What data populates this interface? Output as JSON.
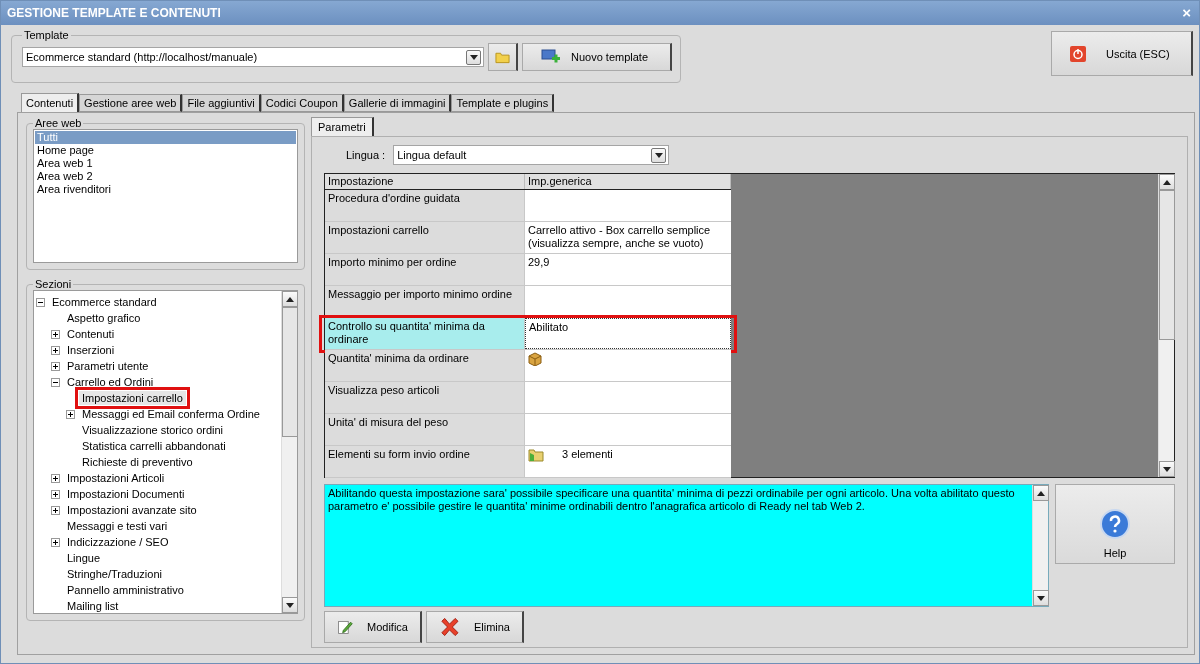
{
  "window": {
    "title": "GESTIONE TEMPLATE E CONTENUTI",
    "close": "×"
  },
  "template_group": {
    "label": "Template",
    "select_value": "Ecommerce standard (http://localhost/manuale)",
    "new_button": "Nuovo template"
  },
  "exit_button": "Uscita (ESC)",
  "tabs": [
    {
      "label": "Contenuti",
      "selected": true
    },
    {
      "label": "Gestione aree web",
      "selected": false
    },
    {
      "label": "File aggiuntivi",
      "selected": false
    },
    {
      "label": "Codici Coupon",
      "selected": false
    },
    {
      "label": "Gallerie di immagini",
      "selected": false
    },
    {
      "label": "Template e plugins",
      "selected": false
    }
  ],
  "aree_web": {
    "label": "Aree web",
    "items": [
      {
        "label": "Tutti",
        "selected": true
      },
      {
        "label": "Home page",
        "selected": false
      },
      {
        "label": "Area web 1",
        "selected": false
      },
      {
        "label": "Area web 2",
        "selected": false
      },
      {
        "label": "Area rivenditori",
        "selected": false
      }
    ]
  },
  "sezioni": {
    "label": "Sezioni",
    "tree": [
      {
        "label": "Ecommerce standard",
        "expanded": true,
        "selected": false,
        "children": [
          {
            "label": "Aspetto grafico",
            "selected": false
          },
          {
            "label": "Contenuti",
            "expanded": false,
            "selected": false
          },
          {
            "label": "Inserzioni",
            "expanded": false,
            "selected": false
          },
          {
            "label": "Parametri utente",
            "expanded": false,
            "selected": false
          },
          {
            "label": "Carrello ed Ordini",
            "expanded": true,
            "selected": false,
            "children": [
              {
                "label": "Impostazioni carrello",
                "selected": true,
                "highlighted": true
              },
              {
                "label": "Messaggi ed Email conferma Ordine",
                "expanded": false,
                "selected": false
              },
              {
                "label": "Visualizzazione storico ordini",
                "selected": false
              },
              {
                "label": "Statistica carrelli abbandonati",
                "selected": false
              },
              {
                "label": "Richieste di preventivo",
                "selected": false
              }
            ]
          },
          {
            "label": "Impostazioni Articoli",
            "expanded": false,
            "selected": false
          },
          {
            "label": "Impostazioni Documenti",
            "expanded": false,
            "selected": false
          },
          {
            "label": "Impostazioni avanzate sito",
            "expanded": false,
            "selected": false
          },
          {
            "label": "Messaggi e testi vari",
            "selected": false
          },
          {
            "label": "Indicizzazione / SEO",
            "expanded": false,
            "selected": false
          },
          {
            "label": "Lingue",
            "selected": false
          },
          {
            "label": "Stringhe/Traduzioni",
            "selected": false
          },
          {
            "label": "Pannello amministrativo",
            "selected": false
          },
          {
            "label": "Mailing list",
            "selected": false
          }
        ]
      }
    ]
  },
  "params_tab": {
    "label": "Parametri",
    "selected": true
  },
  "lingua": {
    "label": "Lingua :",
    "value": "Lingua default"
  },
  "grid": {
    "columns": [
      "Impostazione",
      "Imp.generica"
    ],
    "rows": [
      {
        "name": "Procedura d'ordine guidata",
        "kind": "text",
        "value": "",
        "selected": false
      },
      {
        "name": "Impostazioni carrello",
        "kind": "text",
        "value": "Carrello attivo - Box carrello semplice (visualizza sempre, anche se vuoto)",
        "selected": false
      },
      {
        "name": "Importo minimo per ordine",
        "kind": "text",
        "value": "29,9",
        "selected": false
      },
      {
        "name": "Messaggio per importo minimo ordine",
        "kind": "text",
        "value": "",
        "selected": false
      },
      {
        "name": "Controllo su quantita' minima da ordinare",
        "kind": "text",
        "value": "Abilitato",
        "selected": true,
        "highlighted": true
      },
      {
        "name": "Quantita' minima da ordinare",
        "kind": "icon",
        "value": "",
        "selected": false
      },
      {
        "name": "Visualizza peso articoli",
        "kind": "text",
        "value": "",
        "selected": false
      },
      {
        "name": "Unita' di misura del peso",
        "kind": "text",
        "value": "",
        "selected": false
      },
      {
        "name": "Elementi su form invio ordine",
        "kind": "icon-text",
        "value": "3 elementi",
        "selected": false
      }
    ]
  },
  "description": "Abilitando questa impostazione sara' possibile specificare una quantita' minima di pezzi ordinabile per ogni articolo. Una volta abilitato questo parametro e' possibile gestire le quantita' minime ordinabili dentro l'anagrafica articolo di Ready nel tab Web 2.",
  "help_button": "Help",
  "actions": [
    "Modifica",
    "Elimina"
  ]
}
